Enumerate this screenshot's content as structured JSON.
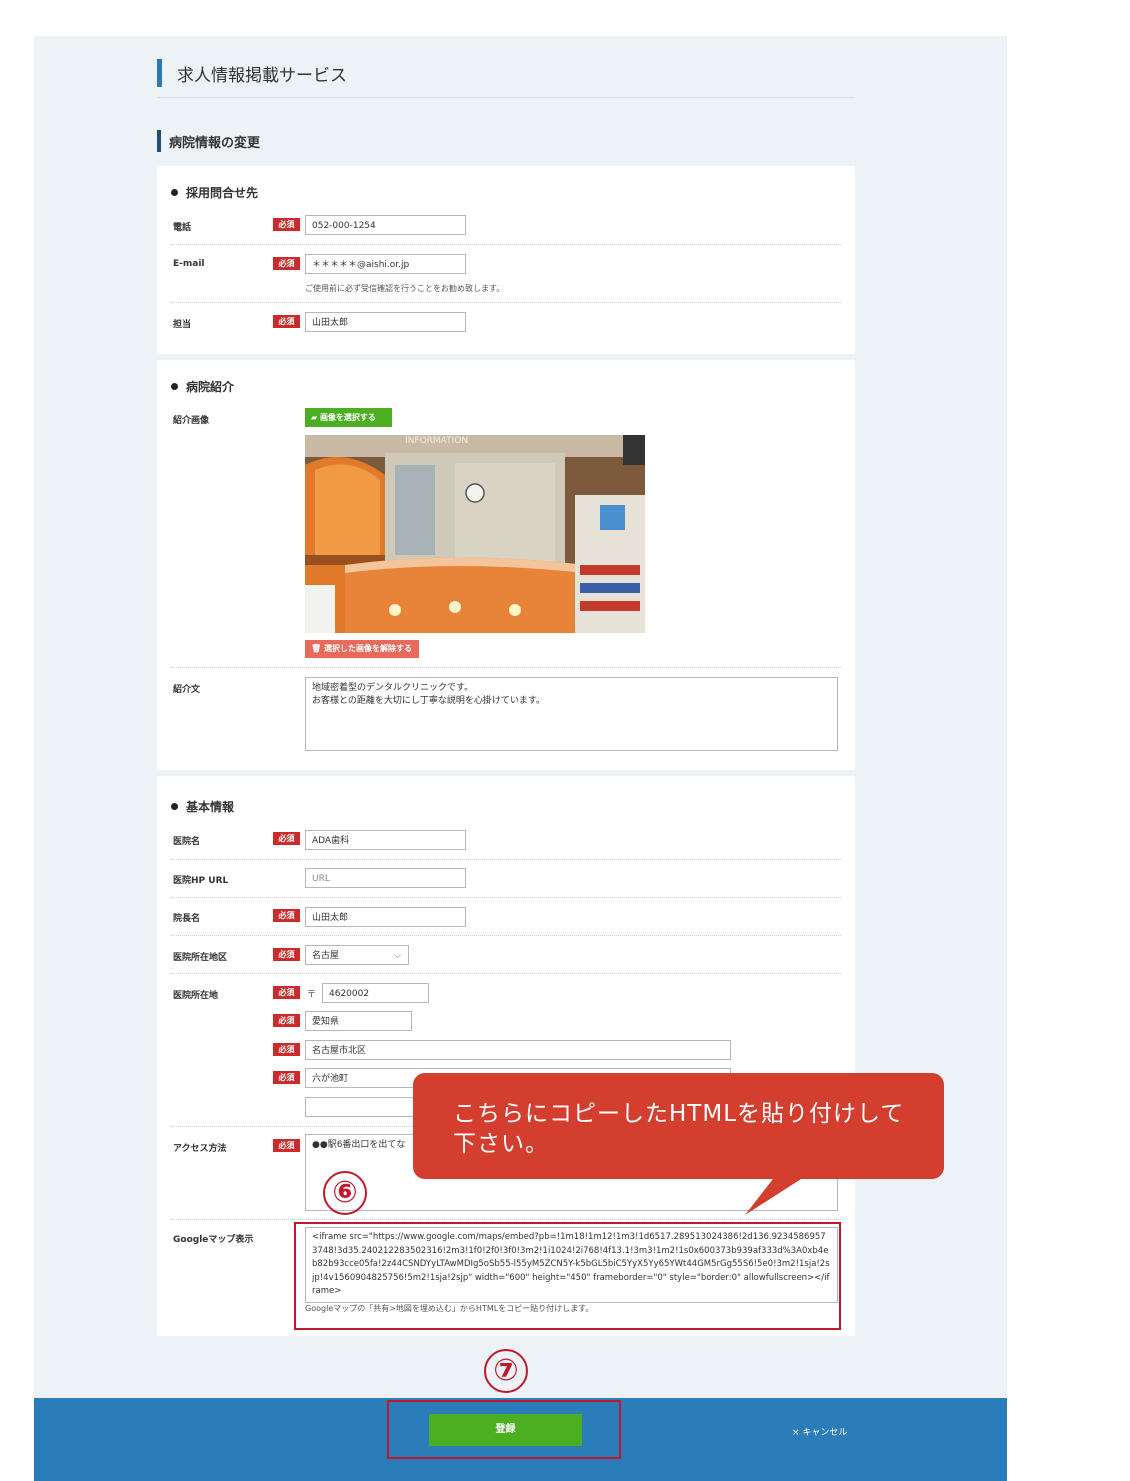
{
  "service": {
    "title": "求人情報掲載サービス"
  },
  "section": {
    "title": "病院情報の変更"
  },
  "contact": {
    "heading": "採用問合せ先",
    "required_label": "必須",
    "phone_label": "電話",
    "phone_value": "052-000-1254",
    "email_label": "E-mail",
    "email_value": "＊＊＊＊＊@aishi.or.jp",
    "email_note": "ご使用前に必ず受信確認を行うことをお勧め致します。",
    "person_label": "担当",
    "person_value": "山田太郎"
  },
  "intro": {
    "heading": "病院紹介",
    "image_label": "紹介画像",
    "select_image_button": "画像を選択する",
    "remove_image_button": "選択した画像を解除する",
    "photo_sign": "INFORMATION",
    "text_label": "紹介文",
    "text_line1": "地域密着型のデンタルクリニックです。",
    "text_line2": "お客様との距離を大切にし丁寧な説明を心掛けています。"
  },
  "basic": {
    "heading": "基本情報",
    "required_label": "必須",
    "hospital_name_label": "医院名",
    "hospital_name_value": "ADA歯科",
    "hp_url_label": "医院HP URL",
    "hp_url_placeholder": "URL",
    "director_label": "院長名",
    "director_value": "山田太郎",
    "district_label": "医院所在地区",
    "district_value": "名古屋",
    "address_label": "医院所在地",
    "postal_mark": "〒",
    "postal_value": "4620002",
    "prefecture_value": "愛知県",
    "city_value": "名古屋市北区",
    "town_value": "六が池町",
    "access_label": "アクセス方法",
    "access_value": "●●駅6番出口を出てな",
    "map_label": "Googleマップ表示",
    "map_code": "<iframe src=\"https://www.google.com/maps/embed?pb=!1m18!1m12!1m3!1d6517.289513024386!2d136.92345869573748!3d35.240212283502316!2m3!1f0!2f0!3f0!3m2!1i1024!2i768!4f13.1!3m3!1m2!1s0x600373b939af333d%3A0xb4eb82b93cce05fa!2z44CSNDYyLTAwMDIg5oSb55-l55yM5ZCN5Y-k5bGL5biC5YyX5Yy65YWt44GM5rGg55S6!5e0!3m2!1sja!2sjp!4v1560904825756!5m2!1sja!2sjp\" width=\"600\" height=\"450\" frameborder=\"0\" style=\"border:0\" allowfullscreen></iframe>",
    "map_note": "Googleマップの「共有>地図を埋め込む」からHTMLをコピー貼り付けします。"
  },
  "callout": {
    "text": "こちらにコピーしたHTMLを貼り付けして下さい。"
  },
  "steps": {
    "six": "⑥",
    "seven": "⑦"
  },
  "footer": {
    "register_button": "登録",
    "cancel_icon": "×",
    "cancel_label": "キャンセル"
  }
}
